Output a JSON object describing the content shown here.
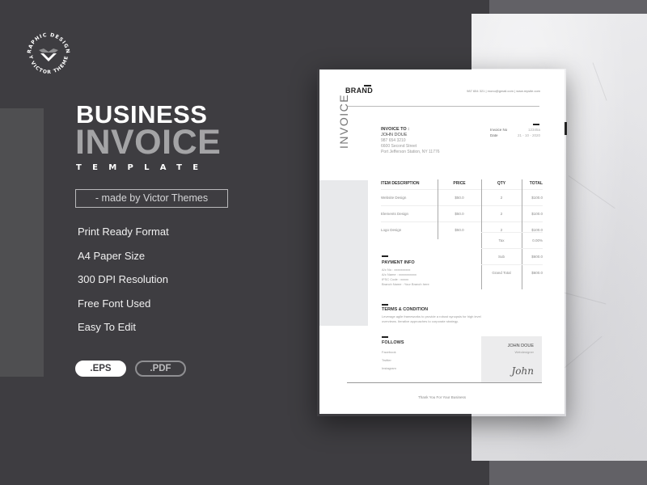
{
  "colors": {
    "background": "#3e3d41",
    "accent_gray": "#a4a4a6",
    "white": "#ffffff"
  },
  "logo": {
    "top_text": "GRAPHIC DESIGNS",
    "bottom_text": "BY VICTOR THEMES",
    "icon": "v-chevron-logo-icon"
  },
  "hero": {
    "line1": "BUSINESS",
    "line2": "INVOICE",
    "line3": "TEMPLATE",
    "made_by": "- made by Victor Themes"
  },
  "features": [
    "Print Ready Format",
    "A4 Paper Size",
    "300 DPI Resolution",
    "Free Font Used",
    "Easy To Edit"
  ],
  "formats": [
    ".EPS",
    ".PDF"
  ],
  "invoice": {
    "brand": "BRAND",
    "contact": "987 654 321  |  mono@gmail.com  |  www.mysite.com",
    "vertical_title": "INVOICE",
    "invoice_to": {
      "label": "INVOICE TO :",
      "name": "JOHN DOUE",
      "phone": "987 654 3210",
      "address1": "6600 Second Street",
      "address2": "Port Jefferson Station, NY 11776"
    },
    "meta": [
      {
        "label": "Invoice No",
        "value": "12345a"
      },
      {
        "label": "Date",
        "value": "21 - 10 - 2020"
      }
    ],
    "table": {
      "headers": [
        "ITEM DESCRIPTION",
        "PRICE",
        "QTY",
        "TOTAL"
      ],
      "rows": [
        [
          "Website Design",
          "$50.0",
          "2",
          "$100.0"
        ],
        [
          "Elements Design",
          "$50.0",
          "2",
          "$100.0"
        ],
        [
          "Logo Design",
          "$50.0",
          "2",
          "$100.0"
        ]
      ]
    },
    "totals": [
      {
        "label": "Tax",
        "value": "0.00%"
      },
      {
        "label": "Sub",
        "value": "$600.0"
      },
      {
        "label": "Grand Total",
        "value": "$600.0"
      }
    ],
    "payment": {
      "title": "PAYMENT INFO",
      "lines": [
        "A/c No  :  xxxxxxxxxx",
        "A/c Name : xxxxxxxxxxx",
        "IFSC Code : xxxxx",
        "Branch Name : Your Branch here"
      ]
    },
    "terms": {
      "title": "TERMS & CONDITION",
      "lines": [
        "Leverage agile frameworks to provide a robust synopsis for high level",
        "overviews. Iterative approaches to corporate strategy."
      ]
    },
    "follows": {
      "title": "FOLLOWS",
      "items": [
        "Facebook",
        "Twitter",
        "Instagram"
      ]
    },
    "signature": {
      "name": "JOHN DOUE",
      "role": "Webdesigner",
      "script": "John"
    },
    "thanks": "Thank You For Your Business"
  }
}
